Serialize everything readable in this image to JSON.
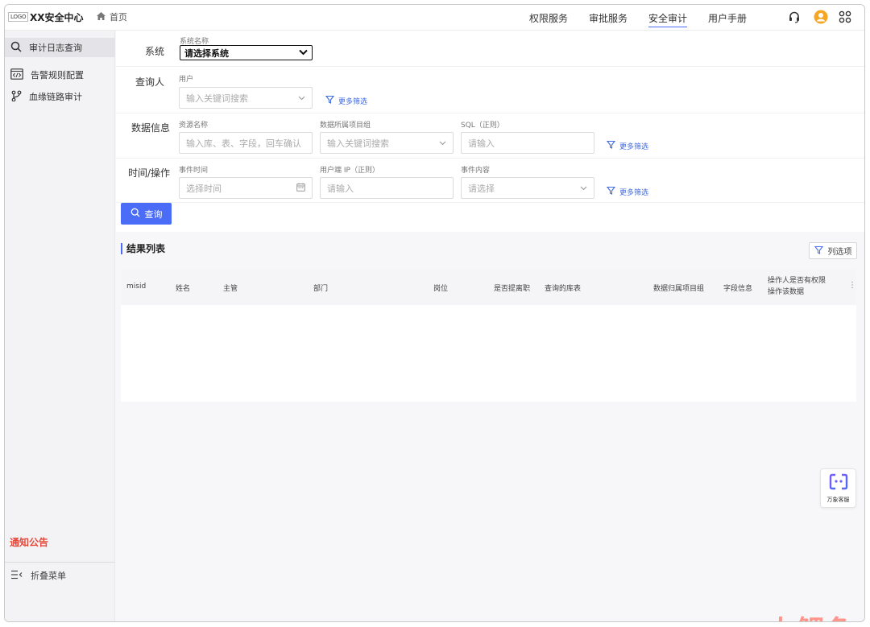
{
  "header": {
    "logo_text": "LOGO",
    "app_title": "XX安全中心",
    "home_label": "首页",
    "nav": [
      {
        "label": "权限服务"
      },
      {
        "label": "审批服务"
      },
      {
        "label": "安全审计"
      },
      {
        "label": "用户手册"
      }
    ],
    "icons": [
      "headset-icon",
      "user-avatar-icon",
      "apps-grid-icon"
    ],
    "accent": "#4a6cf7",
    "avatar_color": "#f5a623"
  },
  "sidebar": {
    "items": [
      {
        "label": "审计日志查询",
        "icon": "search-icon"
      },
      {
        "label": "告警规则配置",
        "icon": "code-window-icon"
      },
      {
        "label": "血缘链路审计",
        "icon": "branch-icon"
      }
    ],
    "notice": "通知公告",
    "collapse_label": "折叠菜单",
    "notice_color": "#e5483b"
  },
  "filters": {
    "system": {
      "row_label": "系统",
      "field_label": "系统名称",
      "selected": "请选择系统"
    },
    "querier": {
      "row_label": "查询人",
      "field_label": "用户",
      "placeholder": "输入关键词搜索",
      "more": "更多筛选"
    },
    "data_info": {
      "row_label": "数据信息",
      "resource_label": "资源名称",
      "resource_placeholder": "输入库、表、字段，回车确认",
      "project_label": "数据所属项目组",
      "project_placeholder": "输入关键词搜索",
      "sql_label": "SQL（正则）",
      "sql_placeholder": "请输入",
      "more": "更多筛选"
    },
    "time_op": {
      "row_label": "时间/操作",
      "time_label": "事件时间",
      "time_placeholder": "选择时间",
      "ip_label": "用户端 IP（正则）",
      "ip_placeholder": "请输入",
      "content_label": "事件内容",
      "content_placeholder": "请选择",
      "more": "更多筛选"
    },
    "search_button": "查询"
  },
  "results": {
    "title": "结果列表",
    "column_options": "列选项",
    "columns": [
      "misid",
      "姓名",
      "主管",
      "部门",
      "岗位",
      "是否提离职",
      "查询的库表",
      "数据归属项目组",
      "字段信息",
      "操作人是否有权限操作该数据"
    ],
    "rows": []
  },
  "floating_service": {
    "label": "万象客服"
  },
  "watermark": "火鲤鱼"
}
